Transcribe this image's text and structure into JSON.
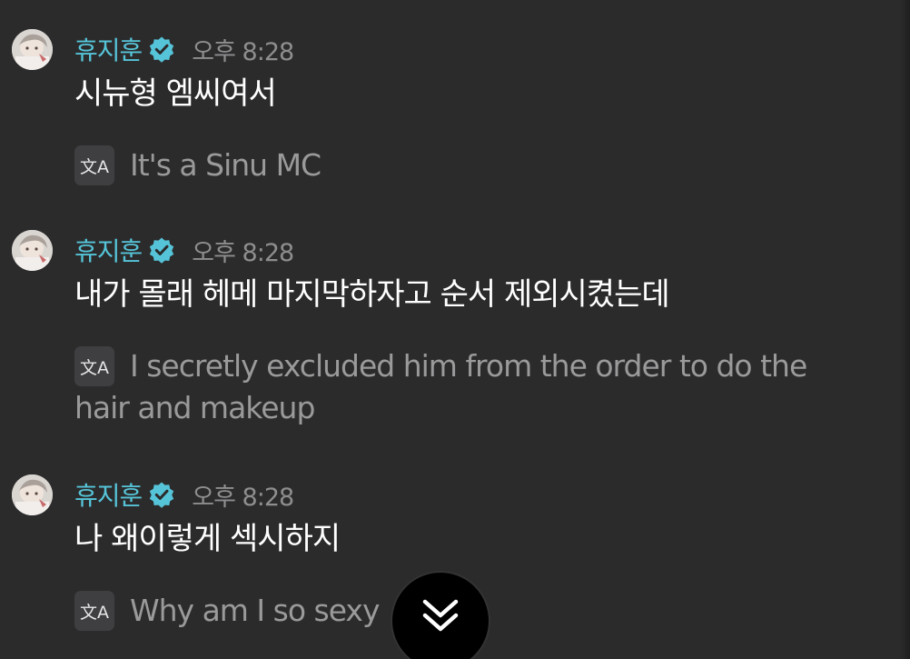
{
  "messages": [
    {
      "sender": "휴지훈",
      "time": "오후 8:28",
      "text": "시뉴형 엠씨여서",
      "translation": "It's a Sinu MC"
    },
    {
      "sender": "휴지훈",
      "time": "오후 8:28",
      "text": "내가 몰래 헤메 마지막하자고 순서 제외시켰는데",
      "translation": "I secretly excluded him from the order to do the hair and makeup"
    },
    {
      "sender": "휴지훈",
      "time": "오후 8:28",
      "text": "나 왜이렇게 섹시하지",
      "translation": "Why am I so sexy"
    }
  ],
  "icons": {
    "verified": "verified-badge-icon",
    "translate": "translate-icon",
    "scroll_down": "double-chevron-down-icon"
  },
  "translate_icon_glyph": "文A",
  "colors": {
    "background": "#2b2b2c",
    "sender_name": "#56c4d8",
    "verified_badge": "#56c4d8",
    "message_text": "#ffffff",
    "translation_text": "#9a9a9b",
    "timestamp": "#8e8e8f"
  }
}
